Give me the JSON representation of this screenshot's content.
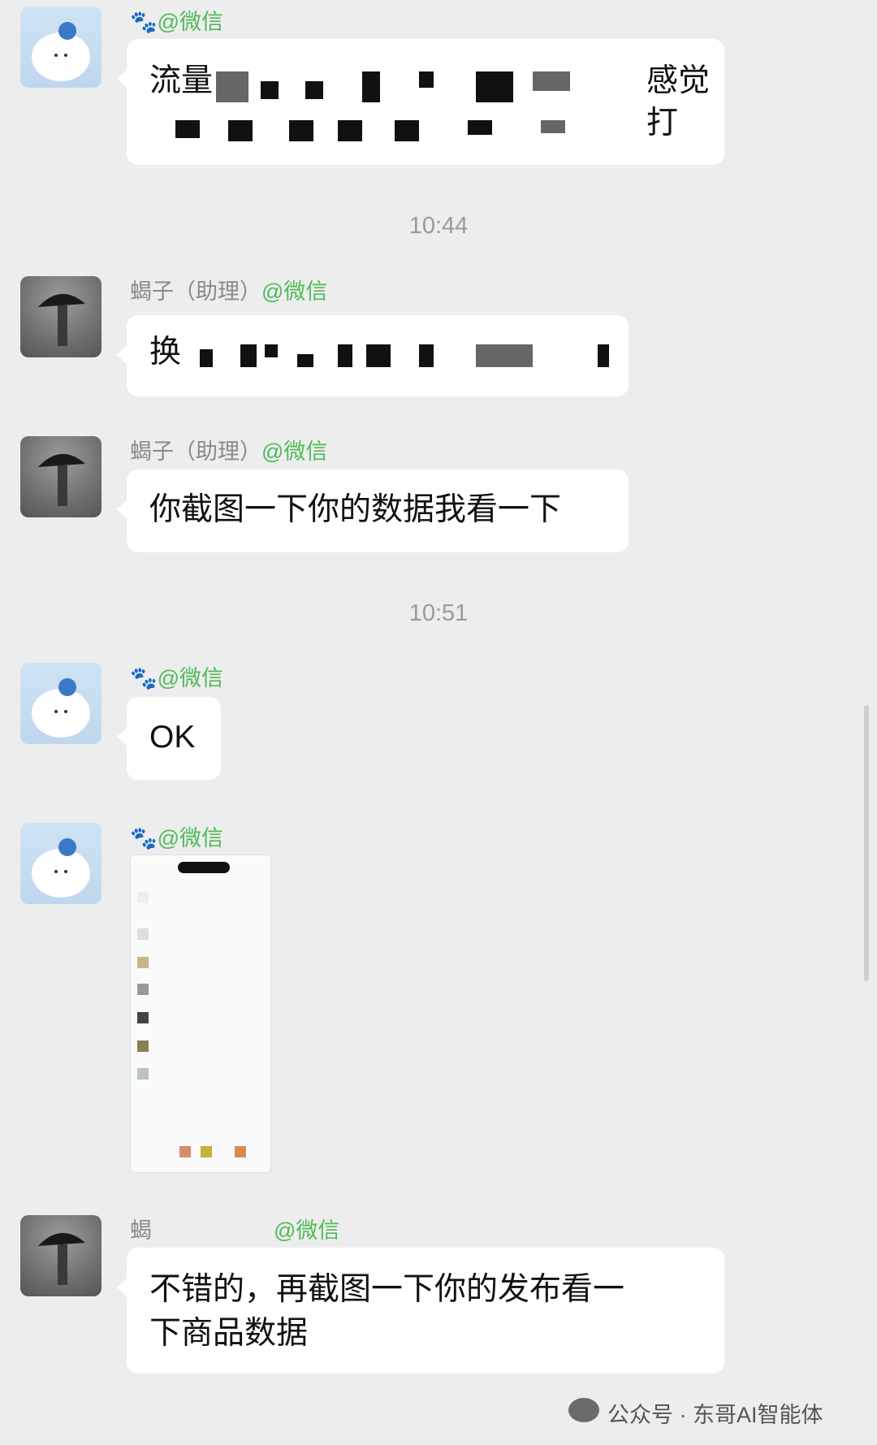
{
  "messages": [
    {
      "sender_handle": "@微信",
      "text_visible": "流量",
      "trail_visible": "感觉打"
    },
    {
      "time": "10:44"
    },
    {
      "sender_name": "蝎子（助理）",
      "sender_handle": "@微信",
      "text_visible": "换"
    },
    {
      "sender_name": "蝎子（助理）",
      "sender_handle": "@微信",
      "text": "你截图一下你的数据我看一下"
    },
    {
      "time": "10:51"
    },
    {
      "sender_handle": "@微信",
      "text": "OK"
    },
    {
      "sender_handle": "@微信"
    },
    {
      "sender_name_visible": "蝎",
      "sender_handle": "@微信",
      "text_line1": "不错的，再截图一下你的发布看一",
      "text_line2": "下商品数据"
    }
  ],
  "paw_glyph": "🐾",
  "watermark": {
    "text": "公众号 · 东哥AI智能体"
  },
  "colors": {
    "background": "#EDEDED",
    "handle_green": "#4EBB58",
    "bubble": "#FFFFFF"
  }
}
